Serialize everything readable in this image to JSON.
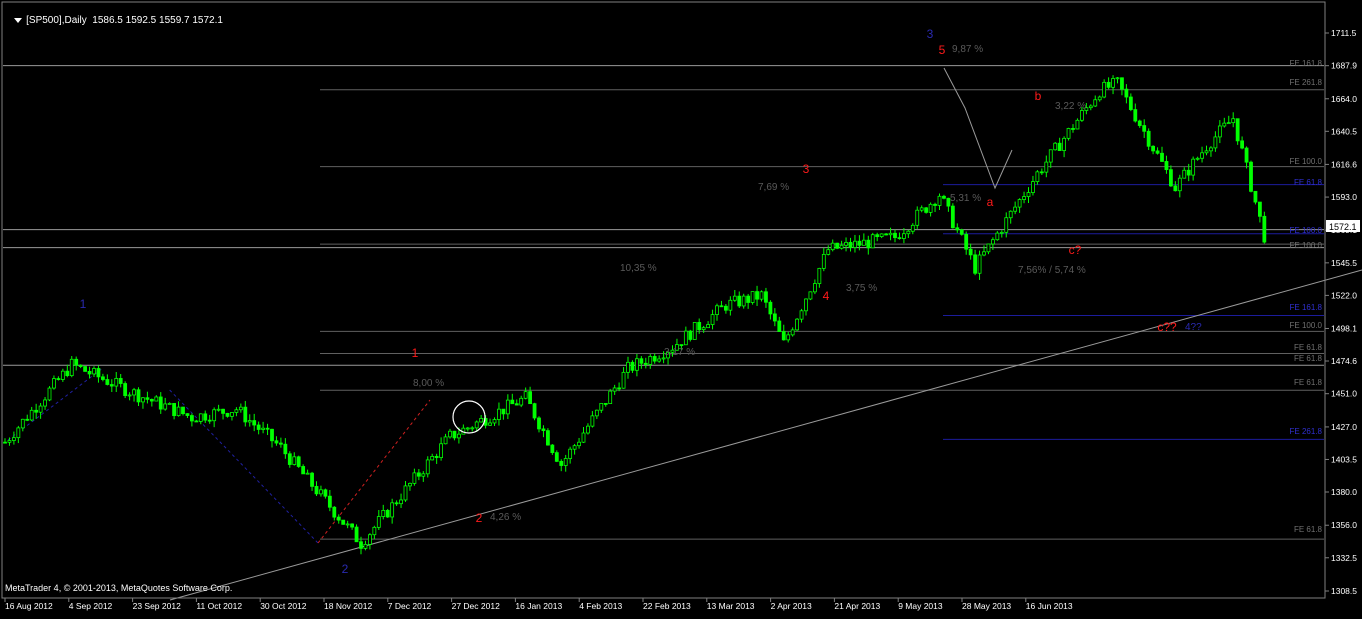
{
  "header": {
    "symbol": "[SP500],Daily",
    "ohlc": "1586.5 1592.5 1559.7 1572.1"
  },
  "footer": {
    "copyright": "MetaTrader 4, © 2001-2013, MetaQuotes Software Corp."
  },
  "colors": {
    "background": "#000000",
    "candles": "#00ff00",
    "price_box": "#ffffff",
    "wave_red": "#ff0000",
    "wave_blue": "#1a1aa0",
    "fib_gray": "#606060",
    "fib_blue": "#1c1c9c"
  },
  "chart_data": {
    "type": "candlestick",
    "title": "[SP500],Daily",
    "ylim": [
      1308.5,
      1722
    ],
    "y_ticks": [
      "1711.5",
      "1687.9",
      "1664.0",
      "1640.5",
      "1616.6",
      "1593.0",
      "1569.1",
      "1545.5",
      "1522.0",
      "1498.1",
      "1474.6",
      "1451.0",
      "1427.0",
      "1403.5",
      "1380.0",
      "1356.0",
      "1332.5",
      "1308.5"
    ],
    "current_price": "1572.1",
    "x_ticks": [
      "16 Aug 2012",
      "4 Sep 2012",
      "23 Sep 2012",
      "11 Oct 2012",
      "30 Oct 2012",
      "18 Nov 2012",
      "7 Dec 2012",
      "27 Dec 2012",
      "16 Jan 2013",
      "4 Feb 2013",
      "22 Feb 2013",
      "13 Mar 2013",
      "2 Apr 2013",
      "21 Apr 2013",
      "9 May 2013",
      "28 May 2013",
      "16 Jun 2013"
    ],
    "waypoints": [
      {
        "bar": 0,
        "price": 1416
      },
      {
        "bar": 15,
        "price": 1472
      },
      {
        "bar": 30,
        "price": 1450
      },
      {
        "bar": 42,
        "price": 1434
      },
      {
        "bar": 52,
        "price": 1440
      },
      {
        "bar": 62,
        "price": 1412
      },
      {
        "bar": 80,
        "price": 1343
      },
      {
        "bar": 100,
        "price": 1420
      },
      {
        "bar": 117,
        "price": 1448
      },
      {
        "bar": 125,
        "price": 1400
      },
      {
        "bar": 140,
        "price": 1469
      },
      {
        "bar": 150,
        "price": 1485
      },
      {
        "bar": 162,
        "price": 1515
      },
      {
        "bar": 170,
        "price": 1522
      },
      {
        "bar": 175,
        "price": 1487
      },
      {
        "bar": 185,
        "price": 1555
      },
      {
        "bar": 200,
        "price": 1564
      },
      {
        "bar": 210,
        "price": 1595
      },
      {
        "bar": 218,
        "price": 1542
      },
      {
        "bar": 232,
        "price": 1610
      },
      {
        "bar": 246,
        "price": 1670
      },
      {
        "bar": 250,
        "price": 1675
      },
      {
        "bar": 263,
        "price": 1600
      },
      {
        "bar": 270,
        "price": 1630
      },
      {
        "bar": 276,
        "price": 1650
      },
      {
        "bar": 283,
        "price": 1565
      }
    ],
    "horizontal_lines": [
      {
        "price": 1687.9,
        "style": "white"
      },
      {
        "price": 1670.5,
        "style": "gray"
      },
      {
        "price": 1615,
        "style": "gray"
      },
      {
        "price": 1602,
        "style": "blue"
      },
      {
        "price": 1569.5,
        "style": "white"
      },
      {
        "price": 1566.5,
        "style": "blue"
      },
      {
        "price": 1559,
        "style": "gray"
      },
      {
        "price": 1556.5,
        "style": "white"
      },
      {
        "price": 1507.5,
        "style": "blue"
      },
      {
        "price": 1496,
        "style": "gray"
      },
      {
        "price": 1480,
        "style": "gray"
      },
      {
        "price": 1471.5,
        "style": "white"
      },
      {
        "price": 1453.5,
        "style": "gray"
      },
      {
        "price": 1418,
        "style": "blue"
      },
      {
        "price": 1346,
        "style": "gray"
      }
    ],
    "fib_labels": [
      "FE 161.8",
      "FE 261.8",
      "FE 100.0",
      "FE 61.8",
      "FE 100.0",
      "FE 100.0",
      "FE 161.8",
      "FE 100.0",
      "FE 61.8",
      "FE 61.8",
      "FE 61.8",
      "FE 261.8",
      "FE 61.8"
    ],
    "wave_labels": [
      {
        "text": "3",
        "color": "blue"
      },
      {
        "text": "5",
        "color": "red"
      },
      {
        "text": "b",
        "color": "red"
      },
      {
        "text": "3",
        "color": "red"
      },
      {
        "text": "a",
        "color": "red"
      },
      {
        "text": "c?",
        "color": "red"
      },
      {
        "text": "4",
        "color": "red"
      },
      {
        "text": "1",
        "color": "blue"
      },
      {
        "text": "1",
        "color": "red"
      },
      {
        "text": "c??",
        "color": "red"
      },
      {
        "text": "2",
        "color": "red"
      },
      {
        "text": "2",
        "color": "blue"
      }
    ],
    "annotations": [
      "9,87 %",
      "3,22 %",
      "7,69 %",
      "5,31 %",
      "10,35 %",
      "7,56% / 5,74 %",
      "3,75 %",
      "3,17 %",
      "8,00 %",
      "4,26 %",
      "4??"
    ]
  }
}
